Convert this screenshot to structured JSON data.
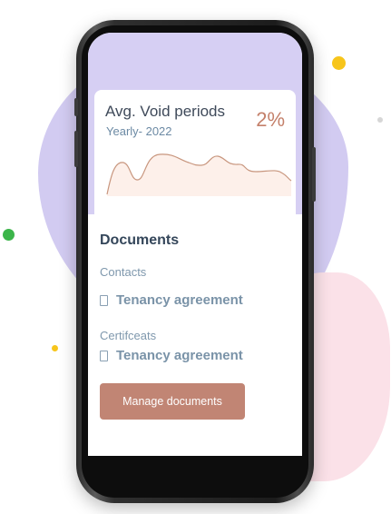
{
  "card": {
    "title": "Avg. Void periods",
    "subtitle": "Yearly- 2022",
    "percent": "2%",
    "sparkline_color": "#c8967e",
    "sparkline_fill": "#fdf0ea"
  },
  "documents": {
    "title": "Documents",
    "sections": [
      {
        "label": "Contacts",
        "item": "Tenancy agreement"
      },
      {
        "label": "Certifceats",
        "item": "Tenancy agreement"
      }
    ],
    "button_label": "Manage documents",
    "button_color": "#c18574"
  },
  "colors": {
    "purple_blob": "#d2cbf1",
    "pink_blob": "#fbe1e8",
    "dot_yellow": "#f7c51b",
    "dot_green": "#3cb54a",
    "dot_gray": "#d6d6d6"
  }
}
